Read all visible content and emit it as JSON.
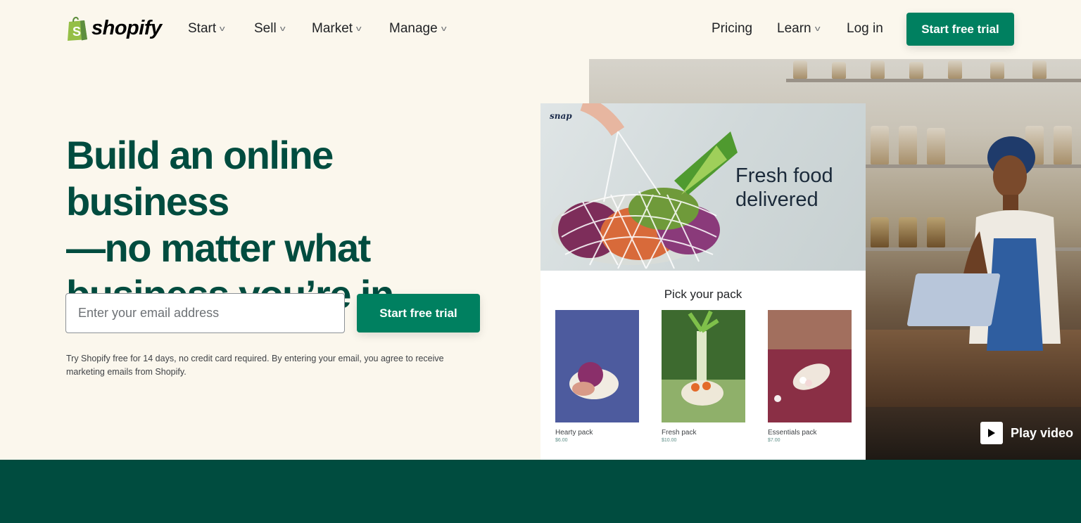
{
  "header": {
    "brand": "shopify",
    "nav_left": [
      {
        "label": "Start",
        "has_dropdown": true
      },
      {
        "label": "Sell",
        "has_dropdown": true
      },
      {
        "label": "Market",
        "has_dropdown": true
      },
      {
        "label": "Manage",
        "has_dropdown": true
      }
    ],
    "nav_right": [
      {
        "label": "Pricing",
        "has_dropdown": false
      },
      {
        "label": "Learn",
        "has_dropdown": true
      },
      {
        "label": "Log in",
        "has_dropdown": false
      }
    ],
    "cta_label": "Start free trial"
  },
  "hero": {
    "headline_lines": [
      "Build an online business",
      "—no matter what",
      "business you’re in"
    ],
    "email_placeholder": "Enter your email address",
    "email_value": "",
    "cta_label": "Start free trial",
    "disclaimer": "Try Shopify free for 14 days, no credit card required. By entering your email, you agree to receive marketing emails from Shopify."
  },
  "showcase": {
    "store_logo": "snap",
    "banner_text_lines": [
      "Fresh food",
      "delivered"
    ],
    "section_title": "Pick your pack",
    "packs": [
      {
        "name": "Hearty pack",
        "price": "$6.00"
      },
      {
        "name": "Fresh pack",
        "price": "$10.00"
      },
      {
        "name": "Essentials pack",
        "price": "$7.00"
      }
    ],
    "play_label": "Play video"
  },
  "colors": {
    "brand_green": "#008060",
    "headline_green": "#004c3f",
    "page_bg": "#fbf7ed",
    "logo_green": "#95bf47"
  }
}
